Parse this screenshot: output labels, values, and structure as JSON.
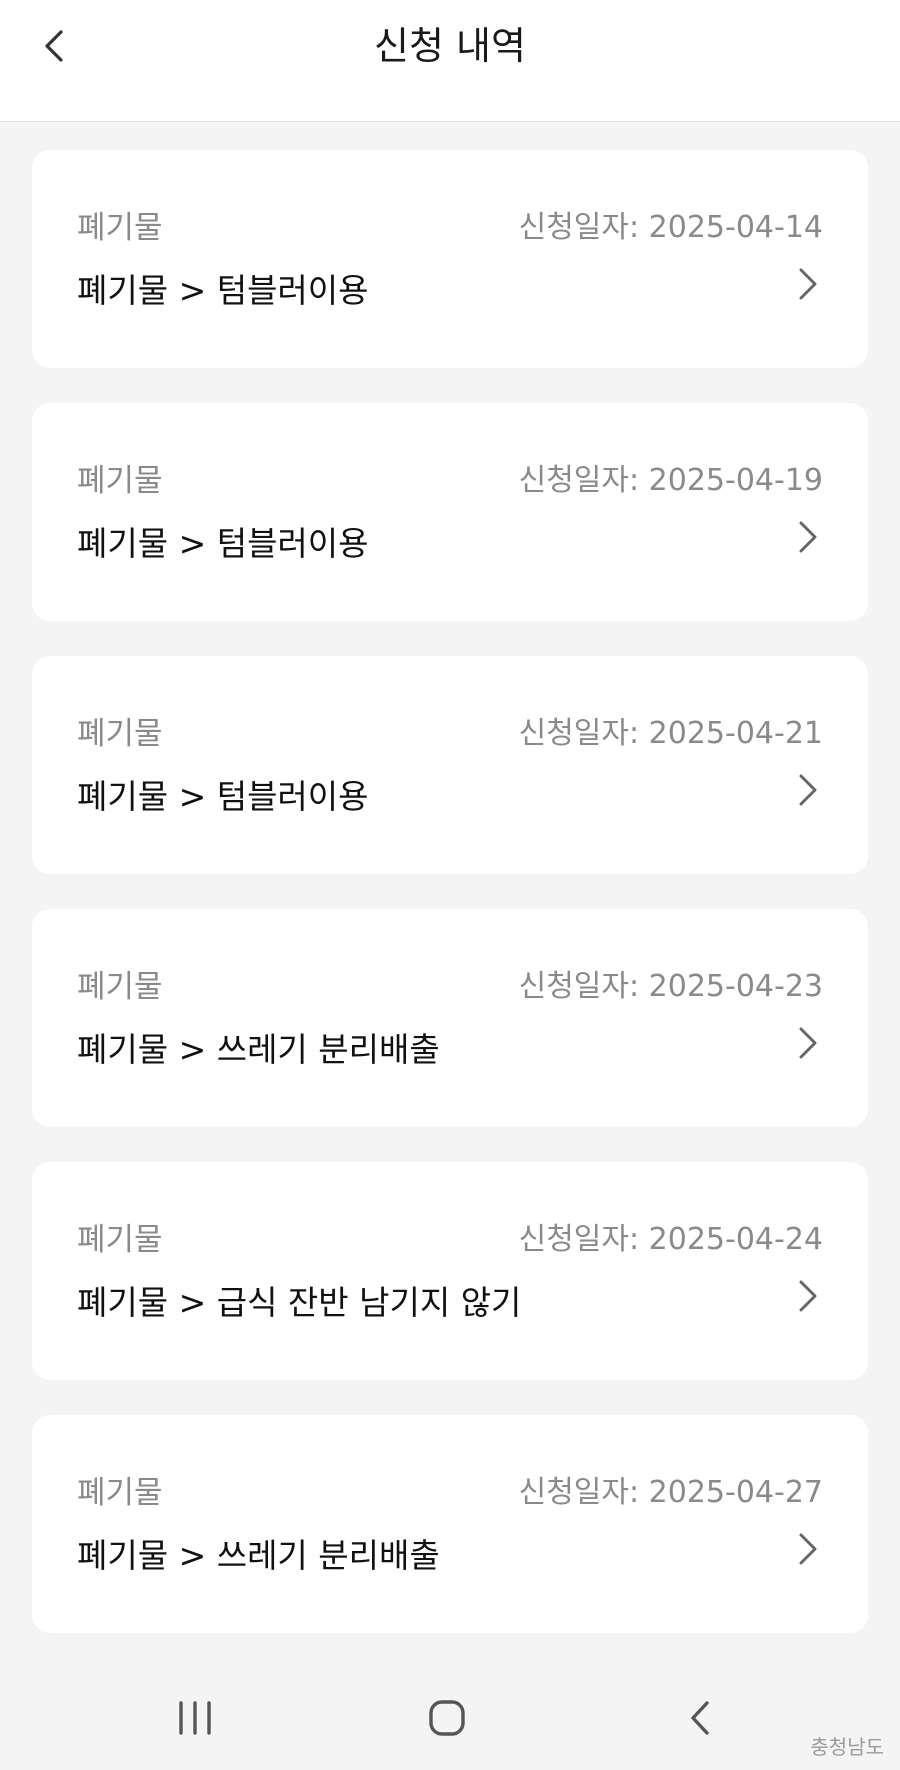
{
  "header": {
    "title": "신청 내역",
    "back_icon": "chevron-left-icon"
  },
  "records": [
    {
      "category": "폐기물",
      "date_label": "신청일자: 2025-04-14",
      "title": "폐기물 > 텀블러이용"
    },
    {
      "category": "폐기물",
      "date_label": "신청일자: 2025-04-19",
      "title": "폐기물 > 텀블러이용"
    },
    {
      "category": "폐기물",
      "date_label": "신청일자: 2025-04-21",
      "title": "폐기물 > 텀블러이용"
    },
    {
      "category": "폐기물",
      "date_label": "신청일자: 2025-04-23",
      "title": "폐기물 > 쓰레기 분리배출"
    },
    {
      "category": "폐기물",
      "date_label": "신청일자: 2025-04-24",
      "title": "폐기물 > 급식 잔반 남기지 않기"
    },
    {
      "category": "폐기물",
      "date_label": "신청일자: 2025-04-27",
      "title": "폐기물 > 쓰레기 분리배출"
    }
  ],
  "nav": {
    "recent_icon": "recent-apps-icon",
    "home_icon": "home-icon",
    "back_icon": "back-icon"
  },
  "watermark": "충청남도",
  "colors": {
    "background": "#f4f4f4",
    "card": "#ffffff",
    "secondary_text": "#8a8a8a",
    "primary_text": "#111111"
  }
}
